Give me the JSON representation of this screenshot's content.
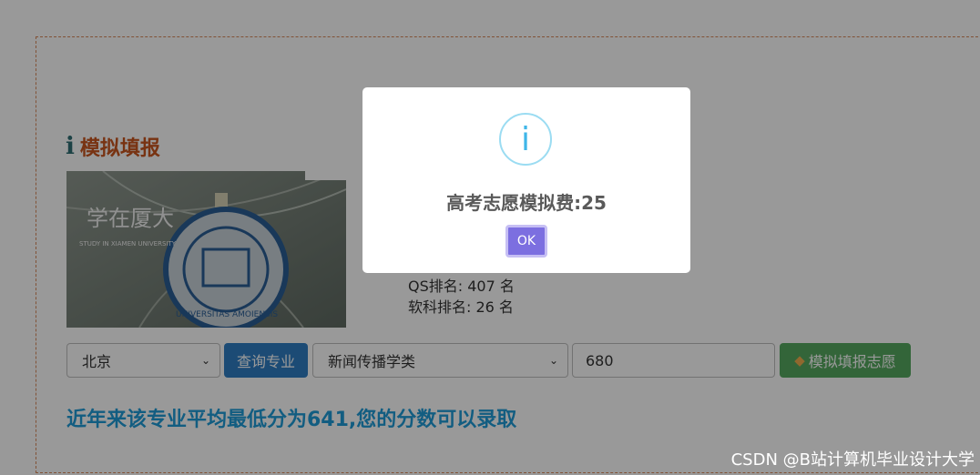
{
  "section": {
    "title": "模拟填报",
    "icon": "info-icon"
  },
  "university": {
    "image_caption_cn": "学在厦大",
    "image_caption_en": "STUDY IN XIAMEN UNIVERSITY",
    "image_seal_text": "UNIVERSITAS AMOIENSIS",
    "qs_rank": "QS排名: 407 名",
    "soft_rank": "软科排名: 26 名"
  },
  "form": {
    "province_value": "北京",
    "query_button": "查询专业",
    "major_value": "新闻传播学类",
    "score_value": "680",
    "submit_button": "模拟填报志愿"
  },
  "result_text": "近年来该专业平均最低分为641,您的分数可以录取",
  "modal": {
    "icon_glyph": "i",
    "message": "高考志愿模拟费:25",
    "ok_label": "OK"
  },
  "watermark": "CSDN @B站计算机毕业设计大学",
  "colors": {
    "title": "#c9551f",
    "result": "#1f9bd8",
    "query_button": "#2f7ec4",
    "submit_button": "#56a960",
    "ok_button": "#7c6fe0",
    "modal_icon": "#3fb6e8"
  }
}
